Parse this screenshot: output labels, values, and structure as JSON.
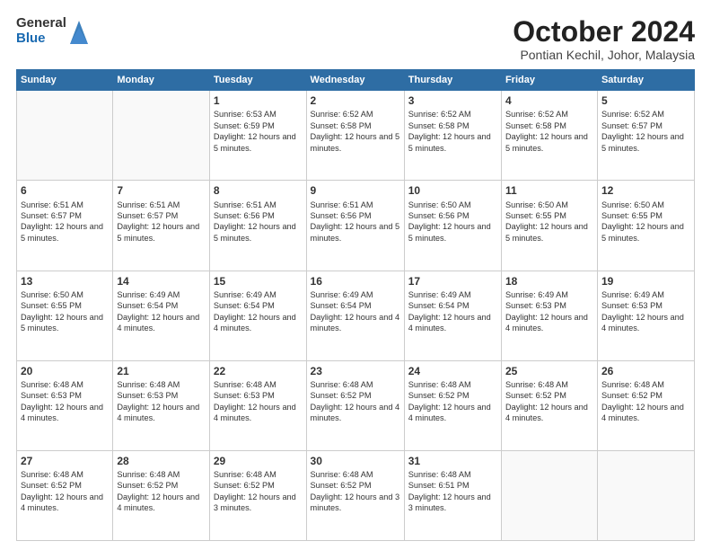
{
  "header": {
    "logo_general": "General",
    "logo_blue": "Blue",
    "title": "October 2024",
    "location": "Pontian Kechil, Johor, Malaysia"
  },
  "days_of_week": [
    "Sunday",
    "Monday",
    "Tuesday",
    "Wednesday",
    "Thursday",
    "Friday",
    "Saturday"
  ],
  "weeks": [
    [
      {
        "day": "",
        "info": ""
      },
      {
        "day": "",
        "info": ""
      },
      {
        "day": "1",
        "info": "Sunrise: 6:53 AM\nSunset: 6:59 PM\nDaylight: 12 hours and 5 minutes."
      },
      {
        "day": "2",
        "info": "Sunrise: 6:52 AM\nSunset: 6:58 PM\nDaylight: 12 hours and 5 minutes."
      },
      {
        "day": "3",
        "info": "Sunrise: 6:52 AM\nSunset: 6:58 PM\nDaylight: 12 hours and 5 minutes."
      },
      {
        "day": "4",
        "info": "Sunrise: 6:52 AM\nSunset: 6:58 PM\nDaylight: 12 hours and 5 minutes."
      },
      {
        "day": "5",
        "info": "Sunrise: 6:52 AM\nSunset: 6:57 PM\nDaylight: 12 hours and 5 minutes."
      }
    ],
    [
      {
        "day": "6",
        "info": "Sunrise: 6:51 AM\nSunset: 6:57 PM\nDaylight: 12 hours and 5 minutes."
      },
      {
        "day": "7",
        "info": "Sunrise: 6:51 AM\nSunset: 6:57 PM\nDaylight: 12 hours and 5 minutes."
      },
      {
        "day": "8",
        "info": "Sunrise: 6:51 AM\nSunset: 6:56 PM\nDaylight: 12 hours and 5 minutes."
      },
      {
        "day": "9",
        "info": "Sunrise: 6:51 AM\nSunset: 6:56 PM\nDaylight: 12 hours and 5 minutes."
      },
      {
        "day": "10",
        "info": "Sunrise: 6:50 AM\nSunset: 6:56 PM\nDaylight: 12 hours and 5 minutes."
      },
      {
        "day": "11",
        "info": "Sunrise: 6:50 AM\nSunset: 6:55 PM\nDaylight: 12 hours and 5 minutes."
      },
      {
        "day": "12",
        "info": "Sunrise: 6:50 AM\nSunset: 6:55 PM\nDaylight: 12 hours and 5 minutes."
      }
    ],
    [
      {
        "day": "13",
        "info": "Sunrise: 6:50 AM\nSunset: 6:55 PM\nDaylight: 12 hours and 5 minutes."
      },
      {
        "day": "14",
        "info": "Sunrise: 6:49 AM\nSunset: 6:54 PM\nDaylight: 12 hours and 4 minutes."
      },
      {
        "day": "15",
        "info": "Sunrise: 6:49 AM\nSunset: 6:54 PM\nDaylight: 12 hours and 4 minutes."
      },
      {
        "day": "16",
        "info": "Sunrise: 6:49 AM\nSunset: 6:54 PM\nDaylight: 12 hours and 4 minutes."
      },
      {
        "day": "17",
        "info": "Sunrise: 6:49 AM\nSunset: 6:54 PM\nDaylight: 12 hours and 4 minutes."
      },
      {
        "day": "18",
        "info": "Sunrise: 6:49 AM\nSunset: 6:53 PM\nDaylight: 12 hours and 4 minutes."
      },
      {
        "day": "19",
        "info": "Sunrise: 6:49 AM\nSunset: 6:53 PM\nDaylight: 12 hours and 4 minutes."
      }
    ],
    [
      {
        "day": "20",
        "info": "Sunrise: 6:48 AM\nSunset: 6:53 PM\nDaylight: 12 hours and 4 minutes."
      },
      {
        "day": "21",
        "info": "Sunrise: 6:48 AM\nSunset: 6:53 PM\nDaylight: 12 hours and 4 minutes."
      },
      {
        "day": "22",
        "info": "Sunrise: 6:48 AM\nSunset: 6:53 PM\nDaylight: 12 hours and 4 minutes."
      },
      {
        "day": "23",
        "info": "Sunrise: 6:48 AM\nSunset: 6:52 PM\nDaylight: 12 hours and 4 minutes."
      },
      {
        "day": "24",
        "info": "Sunrise: 6:48 AM\nSunset: 6:52 PM\nDaylight: 12 hours and 4 minutes."
      },
      {
        "day": "25",
        "info": "Sunrise: 6:48 AM\nSunset: 6:52 PM\nDaylight: 12 hours and 4 minutes."
      },
      {
        "day": "26",
        "info": "Sunrise: 6:48 AM\nSunset: 6:52 PM\nDaylight: 12 hours and 4 minutes."
      }
    ],
    [
      {
        "day": "27",
        "info": "Sunrise: 6:48 AM\nSunset: 6:52 PM\nDaylight: 12 hours and 4 minutes."
      },
      {
        "day": "28",
        "info": "Sunrise: 6:48 AM\nSunset: 6:52 PM\nDaylight: 12 hours and 4 minutes."
      },
      {
        "day": "29",
        "info": "Sunrise: 6:48 AM\nSunset: 6:52 PM\nDaylight: 12 hours and 3 minutes."
      },
      {
        "day": "30",
        "info": "Sunrise: 6:48 AM\nSunset: 6:52 PM\nDaylight: 12 hours and 3 minutes."
      },
      {
        "day": "31",
        "info": "Sunrise: 6:48 AM\nSunset: 6:51 PM\nDaylight: 12 hours and 3 minutes."
      },
      {
        "day": "",
        "info": ""
      },
      {
        "day": "",
        "info": ""
      }
    ]
  ]
}
